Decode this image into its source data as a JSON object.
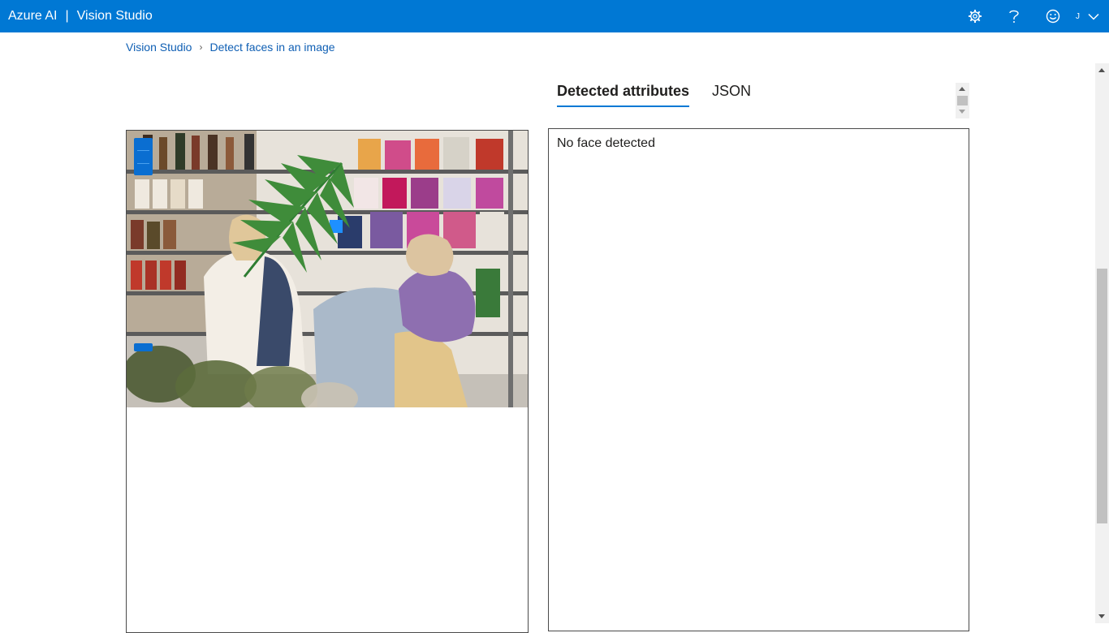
{
  "header": {
    "brand": "Azure AI",
    "separator": "|",
    "product": "Vision Studio",
    "account_initial": "J",
    "icons": [
      "settings-gear-icon",
      "help-question-icon",
      "feedback-smiley-icon",
      "chevron-down-icon"
    ],
    "accent_color": "#0078d4"
  },
  "breadcrumb": {
    "items": [
      "Vision Studio",
      "Detect faces in an image"
    ]
  },
  "results": {
    "tabs": [
      {
        "label": "Detected attributes",
        "active": true
      },
      {
        "label": "JSON",
        "active": false
      }
    ],
    "message": "No face detected"
  }
}
